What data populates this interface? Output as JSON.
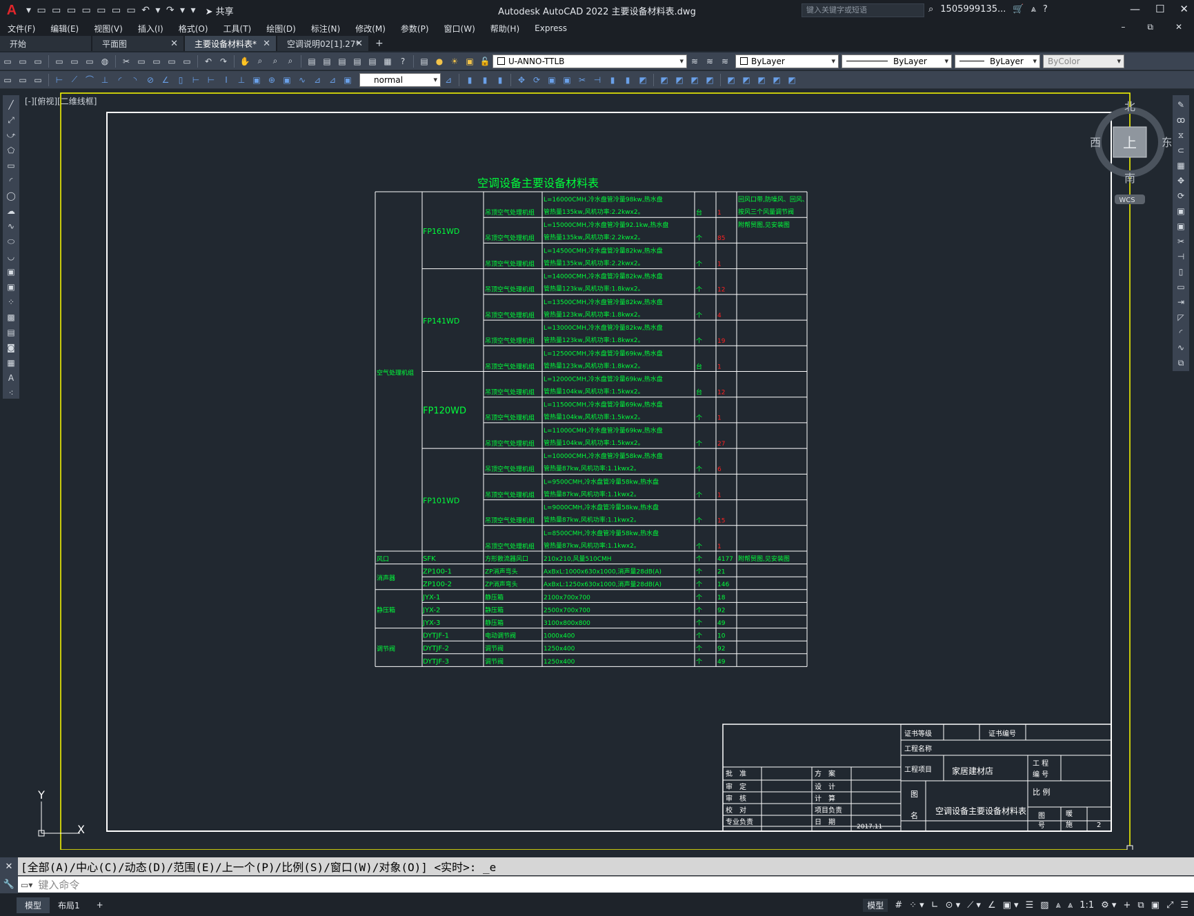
{
  "app": {
    "title": "Autodesk AutoCAD 2022    主要设备材料表.dwg",
    "share": "共享",
    "search_placeholder": "键入关键字或短语",
    "user": "1505999135...",
    "logo": "A"
  },
  "menu": [
    "文件(F)",
    "编辑(E)",
    "视图(V)",
    "插入(I)",
    "格式(O)",
    "工具(T)",
    "绘图(D)",
    "标注(N)",
    "修改(M)",
    "参数(P)",
    "窗口(W)",
    "帮助(H)",
    "Express"
  ],
  "tabs": [
    {
      "label": "开始",
      "close": false
    },
    {
      "label": "平面图",
      "close": true
    },
    {
      "label": "主要设备材料表*",
      "close": true,
      "active": true
    },
    {
      "label": "空调说明02[1].27*",
      "close": true
    }
  ],
  "toolbar": {
    "layer": "U-ANNO-TTLB",
    "color": "ByLayer",
    "linetype": "ByLayer",
    "lineweight": "ByLayer",
    "plotstyle": "ByColor",
    "textstyle": "normal"
  },
  "viewport": {
    "label": "[-][俯视][二维线框]",
    "cube": {
      "north": "北",
      "south": "南",
      "east": "东",
      "west": "西",
      "top": "上",
      "wcs": "WCS"
    },
    "ucs": {
      "x": "X",
      "y": "Y"
    }
  },
  "colors": {
    "green": "#00ff3b",
    "red": "#ff2020",
    "yellow": "#ffff00",
    "white": "#ffffff"
  },
  "drawing": {
    "title": "空调设备主要设备材料表",
    "group_ahu": "空气处理机组",
    "models": [
      "FP161WD",
      "FP141WD",
      "FP120WD",
      "FP101WD"
    ],
    "ahu_name": "吊顶空气处理机组",
    "ahu_rows": [
      {
        "l1": "L=16000CMH,冷水盘管冷量98kw,热水盘",
        "l2": "管热量135kw,风机功率:2.2kwx2。",
        "unit": "台",
        "qty": "1",
        "note1": "回风口带,防噪风、回风、",
        "note2": "按风三个风量调节阀"
      },
      {
        "l1": "L=15000CMH,冷水盘管冷量92.1kw,热水盘",
        "l2": "管热量135kw,风机功率:2.2kwx2。",
        "unit": "个",
        "qty": "85",
        "note1": "附帮贸图,见安装图",
        "note2": ""
      },
      {
        "l1": "L=14500CMH,冷水盘管冷量82kw,热水盘",
        "l2": "管热量135kw,风机功率:2.2kwx2。",
        "unit": "个",
        "qty": "1",
        "note1": "",
        "note2": ""
      },
      {
        "l1": "L=14000CMH,冷水盘管冷量82kw,热水盘",
        "l2": "管热量123kw,风机功率:1.8kwx2。",
        "unit": "个",
        "qty": "12",
        "note1": "",
        "note2": ""
      },
      {
        "l1": "L=13500CMH,冷水盘管冷量82kw,热水盘",
        "l2": "管热量123kw,风机功率:1.8kwx2。",
        "unit": "个",
        "qty": "4",
        "note1": "",
        "note2": ""
      },
      {
        "l1": "L=13000CMH,冷水盘管冷量82kw,热水盘",
        "l2": "管热量123kw,风机功率:1.8kwx2。",
        "unit": "个",
        "qty": "19",
        "note1": "",
        "note2": ""
      },
      {
        "l1": "L=12500CMH,冷水盘管冷量69kw,热水盘",
        "l2": "管热量123kw,风机功率:1.8kwx2。",
        "unit": "台",
        "qty": "1",
        "note1": "",
        "note2": ""
      },
      {
        "l1": "L=12000CMH,冷水盘管冷量69kw,热水盘",
        "l2": "管热量104kw,风机功率:1.5kwx2。",
        "unit": "台",
        "qty": "12",
        "note1": "",
        "note2": ""
      },
      {
        "l1": "L=11500CMH,冷水盘管冷量69kw,热水盘",
        "l2": "管热量104kw,风机功率:1.5kwx2。",
        "unit": "个",
        "qty": "1",
        "note1": "",
        "note2": ""
      },
      {
        "l1": "L=11000CMH,冷水盘管冷量69kw,热水盘",
        "l2": "管热量104kw,风机功率:1.5kwx2。",
        "unit": "个",
        "qty": "27",
        "note1": "",
        "note2": ""
      },
      {
        "l1": "L=10000CMH,冷水盘管冷量58kw,热水盘",
        "l2": "管热量87kw,风机功率:1.1kwx2。",
        "unit": "个",
        "qty": "6",
        "note1": "",
        "note2": ""
      },
      {
        "l1": "L=9500CMH,冷水盘管冷量58kw,热水盘",
        "l2": "管热量87kw,风机功率:1.1kwx2。",
        "unit": "个",
        "qty": "1",
        "note1": "",
        "note2": ""
      },
      {
        "l1": "L=9000CMH,冷水盘管冷量58kw,热水盘",
        "l2": "管热量87kw,风机功率:1.1kwx2。",
        "unit": "个",
        "qty": "15",
        "note1": "",
        "note2": ""
      },
      {
        "l1": "L=8500CMH,冷水盘管冷量58kw,热水盘",
        "l2": "管热量87kw,风机功率:1.1kwx2。",
        "unit": "个",
        "qty": "1",
        "note1": "",
        "note2": ""
      }
    ],
    "other_rows": [
      {
        "cat": "风口",
        "model": "SFK",
        "name": "方形散流器风口",
        "spec": "210x210,风量510CMH",
        "unit": "个",
        "qty": "4177",
        "note": "附帮贸图,见安装图"
      },
      {
        "cat": "消声器",
        "model": "ZP100-1",
        "name": "ZP消声弯头",
        "spec": "AxBxL:1000x630x1000,消声量28dB(A)",
        "unit": "个",
        "qty": "21",
        "note": ""
      },
      {
        "cat": "",
        "model": "ZP100-2",
        "name": "ZP消声弯头",
        "spec": "AxBxL:1250x630x1000,消声量28dB(A)",
        "unit": "个",
        "qty": "146",
        "note": ""
      },
      {
        "cat": "静压箱",
        "model": "JYX-1",
        "name": "静压箱",
        "spec": "2100x700x700",
        "unit": "个",
        "qty": "18",
        "note": ""
      },
      {
        "cat": "",
        "model": "JYX-2",
        "name": "静压箱",
        "spec": "2500x700x700",
        "unit": "个",
        "qty": "92",
        "note": ""
      },
      {
        "cat": "",
        "model": "JYX-3",
        "name": "静压箱",
        "spec": "3100x800x800",
        "unit": "个",
        "qty": "49",
        "note": ""
      },
      {
        "cat": "调节阀",
        "model": "DYTJF-1",
        "name": "电动调节阀",
        "spec": "1000x400",
        "unit": "个",
        "qty": "10",
        "note": ""
      },
      {
        "cat": "",
        "model": "DYTJF-2",
        "name": "调节阀",
        "spec": "1250x400",
        "unit": "个",
        "qty": "92",
        "note": ""
      },
      {
        "cat": "",
        "model": "DYTJF-3",
        "name": "调节阀",
        "spec": "1250x400",
        "unit": "个",
        "qty": "49",
        "note": ""
      }
    ]
  },
  "titleblock": {
    "cert_level": "证书等级",
    "cert_no": "证书编号",
    "proj_name": "工程名称",
    "proj_item": "工程项目",
    "proj_item_val": "家居建材店",
    "proj_no": "工 程\n编 号",
    "drawing": "图\n\n名",
    "drawing_val": "空调设备主要设备材料表",
    "scale": "比 例",
    "dwgno": "图\n号",
    "dwgno_a": "暖",
    "dwgno_b": "施",
    "dwgno_c": "2",
    "approve": "批　准",
    "review": "审　定",
    "check": "审　核",
    "proof": "校　对",
    "major": "专业负责",
    "scheme": "方　案",
    "design": "设　计",
    "calc": "计　算",
    "pm": "项目负责",
    "date": "日　期",
    "date_val": "2017.11"
  },
  "command": {
    "history": "[全部(A)/中心(C)/动态(D)/范围(E)/上一个(P)/比例(S)/窗口(W)/对象(O)] <实时>: _e",
    "placeholder": "键入命令"
  },
  "status": {
    "tabs": [
      "模型",
      "布局1"
    ],
    "model": "模型",
    "scale": "1:1"
  }
}
